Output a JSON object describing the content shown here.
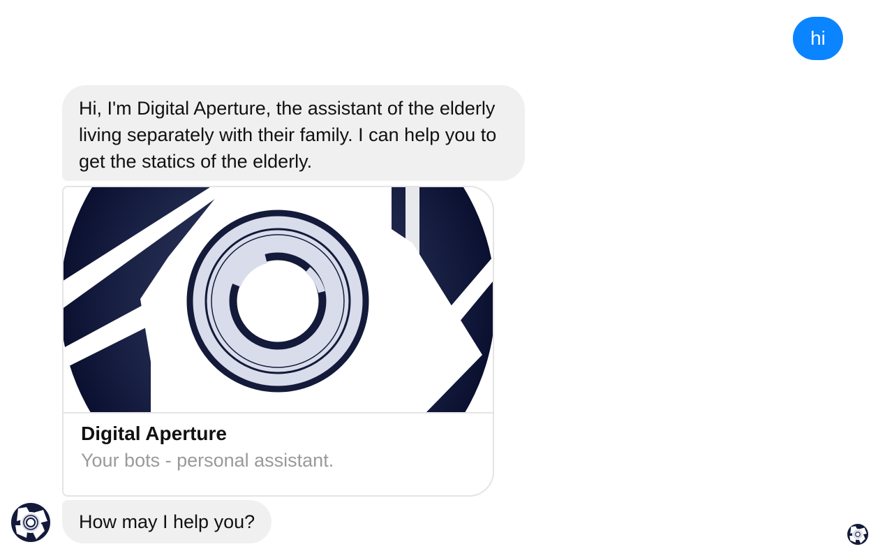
{
  "messages": {
    "user_greeting": "hi",
    "bot_intro": "Hi, I'm Digital Aperture, the assistant of the elderly living separately with their family. I can help you to get the statics of the elderly.",
    "bot_question": "How may I help you?"
  },
  "card": {
    "image_icon": "aperture-logo",
    "title": "Digital Aperture",
    "subtitle": "Your bots - personal assistant."
  },
  "bot": {
    "avatar_icon": "aperture-logo-icon",
    "read_receipt_icon": "aperture-logo-icon"
  },
  "colors": {
    "user_bubble": "#0a84ff",
    "bot_bubble": "#f0f0f0",
    "logo_dark": "#131a3a",
    "logo_light": "#d9dcea"
  }
}
